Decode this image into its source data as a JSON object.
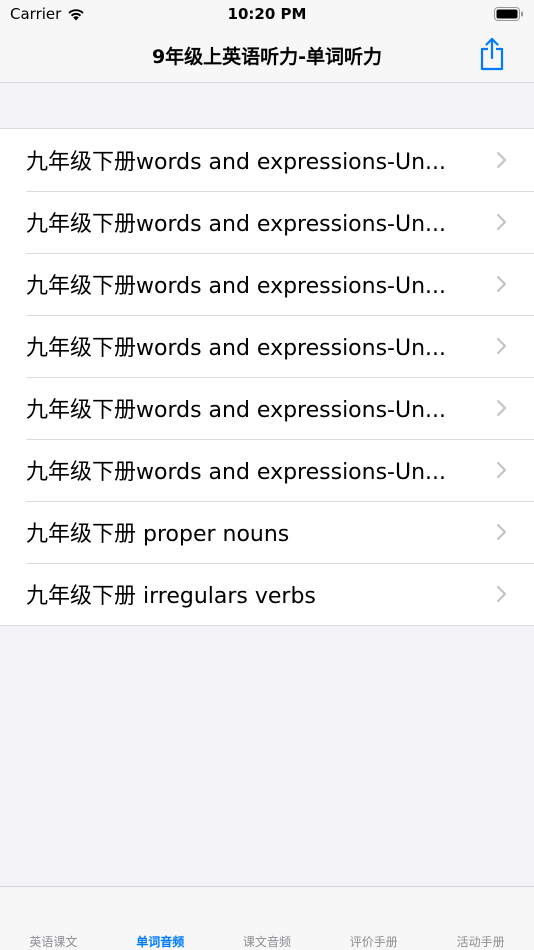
{
  "status_bar": {
    "carrier": "Carrier",
    "time": "10:20 PM"
  },
  "nav": {
    "title": "9年级上英语听力-单词听力",
    "share_icon": "share-icon"
  },
  "list": {
    "items": [
      {
        "label": "九年级下册words and expressions-Un..."
      },
      {
        "label": "九年级下册words and expressions-Un..."
      },
      {
        "label": "九年级下册words and expressions-Un..."
      },
      {
        "label": "九年级下册words and expressions-Un..."
      },
      {
        "label": "九年级下册words and expressions-Un..."
      },
      {
        "label": "九年级下册words and expressions-Un..."
      },
      {
        "label": "九年级下册 proper nouns"
      },
      {
        "label": "九年级下册 irregulars verbs"
      }
    ]
  },
  "tabs": [
    {
      "label": "英语课文",
      "active": false
    },
    {
      "label": "单词音频",
      "active": true
    },
    {
      "label": "课文音频",
      "active": false
    },
    {
      "label": "评价手册",
      "active": false
    },
    {
      "label": "活动手册",
      "active": false
    }
  ],
  "colors": {
    "accent": "#007aff",
    "inactive_tab": "#8e8e93",
    "background": "#f2f2f7"
  }
}
